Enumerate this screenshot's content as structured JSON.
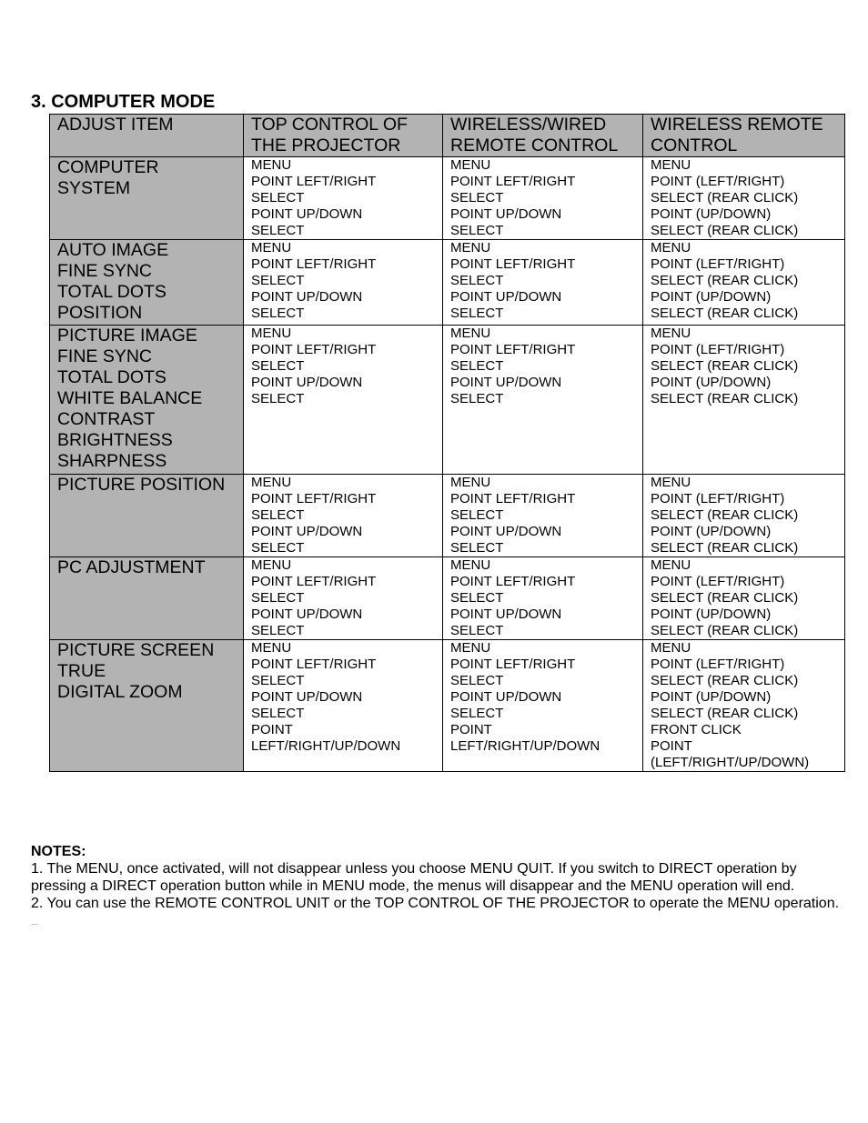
{
  "section": {
    "title": "3. COMPUTER MODE"
  },
  "table": {
    "headers": [
      "ADJUST ITEM",
      "TOP CONTROL OF THE PROJECTOR",
      "WIRELESS/WIRED REMOTE CONTROL",
      "WIRELESS REMOTE CONTROL"
    ],
    "header_lines": [
      [
        "ADJUST ITEM"
      ],
      [
        "TOP CONTROL OF",
        "THE PROJECTOR"
      ],
      [
        "WIRELESS/WIRED",
        "REMOTE CONTROL"
      ],
      [
        "WIRELESS REMOTE",
        "CONTROL"
      ]
    ],
    "rows": [
      {
        "item": [
          "COMPUTER",
          "SYSTEM"
        ],
        "top": [
          "MENU",
          "POINT LEFT/RIGHT",
          "SELECT",
          "POINT UP/DOWN",
          "SELECT"
        ],
        "wired": [
          "MENU",
          "POINT LEFT/RIGHT",
          "SELECT",
          "POINT UP/DOWN",
          "SELECT"
        ],
        "wireless": [
          "MENU",
          "POINT (LEFT/RIGHT)",
          "SELECT (REAR CLICK)",
          "POINT (UP/DOWN)",
          "SELECT (REAR CLICK)"
        ]
      },
      {
        "item": [
          "AUTO IMAGE",
          "FINE SYNC",
          "TOTAL DOTS",
          "POSITION"
        ],
        "top": [
          "MENU",
          "POINT LEFT/RIGHT",
          "SELECT",
          "POINT UP/DOWN",
          "SELECT"
        ],
        "wired": [
          "MENU",
          "POINT LEFT/RIGHT",
          "SELECT",
          "POINT UP/DOWN",
          "SELECT"
        ],
        "wireless": [
          "MENU",
          "POINT (LEFT/RIGHT)",
          "SELECT (REAR CLICK)",
          "POINT (UP/DOWN)",
          "SELECT (REAR CLICK)"
        ]
      },
      {
        "item": [
          "PICTURE IMAGE",
          "FINE SYNC",
          "TOTAL DOTS",
          "WHITE BALANCE",
          "CONTRAST",
          "BRIGHTNESS",
          "SHARPNESS"
        ],
        "top": [
          "MENU",
          "POINT LEFT/RIGHT",
          "SELECT",
          "POINT UP/DOWN",
          "SELECT"
        ],
        "wired": [
          "MENU",
          "POINT LEFT/RIGHT",
          "SELECT",
          "POINT UP/DOWN",
          "SELECT"
        ],
        "wireless": [
          "MENU",
          "POINT (LEFT/RIGHT)",
          "SELECT (REAR CLICK)",
          "POINT (UP/DOWN)",
          "SELECT (REAR CLICK)"
        ]
      },
      {
        "item": [
          "PICTURE POSITION"
        ],
        "top": [
          "MENU",
          "POINT LEFT/RIGHT",
          "SELECT",
          "POINT UP/DOWN",
          "SELECT"
        ],
        "wired": [
          "MENU",
          "POINT LEFT/RIGHT",
          "SELECT",
          "POINT UP/DOWN",
          "SELECT"
        ],
        "wireless": [
          "MENU",
          "POINT (LEFT/RIGHT)",
          "SELECT (REAR CLICK)",
          "POINT (UP/DOWN)",
          "SELECT (REAR CLICK)"
        ]
      },
      {
        "item": [
          "PC ADJUSTMENT"
        ],
        "top": [
          "MENU",
          "POINT LEFT/RIGHT",
          "SELECT",
          "POINT UP/DOWN",
          "SELECT"
        ],
        "wired": [
          "MENU",
          "POINT LEFT/RIGHT",
          "SELECT",
          "POINT UP/DOWN",
          "SELECT"
        ],
        "wireless": [
          "MENU",
          "POINT (LEFT/RIGHT)",
          "SELECT (REAR CLICK)",
          "POINT (UP/DOWN)",
          "SELECT (REAR CLICK)"
        ]
      },
      {
        "item": [
          "PICTURE SCREEN",
          "TRUE",
          "DIGITAL ZOOM"
        ],
        "top": [
          "MENU",
          "POINT LEFT/RIGHT",
          "SELECT",
          "POINT UP/DOWN",
          "SELECT",
          "POINT",
          "LEFT/RIGHT/UP/DOWN"
        ],
        "wired": [
          "MENU",
          "POINT LEFT/RIGHT",
          "SELECT",
          "POINT UP/DOWN",
          "SELECT",
          "POINT",
          "LEFT/RIGHT/UP/DOWN"
        ],
        "wireless": [
          "MENU",
          "POINT (LEFT/RIGHT)",
          "SELECT (REAR CLICK)",
          "POINT (UP/DOWN)",
          "SELECT (REAR CLICK)",
          "FRONT CLICK",
          "POINT",
          "(LEFT/RIGHT/UP/DOWN)"
        ]
      }
    ]
  },
  "notes": {
    "title": "NOTES:",
    "items": [
      "1. The MENU, once activated, will not disappear unless you choose MENU QUIT. If you switch to DIRECT operation by pressing a DIRECT operation button while in MENU mode, the menus will disappear and the MENU operation will end.",
      "2. You can use the REMOTE CONTROL UNIT or the TOP CONTROL OF THE PROJECTOR to operate the MENU operation."
    ],
    "ellipsis": "..."
  },
  "colors": {
    "header_bg": "#b3b3b3",
    "item_bg": "#b3b3b3",
    "border": "#000000"
  }
}
